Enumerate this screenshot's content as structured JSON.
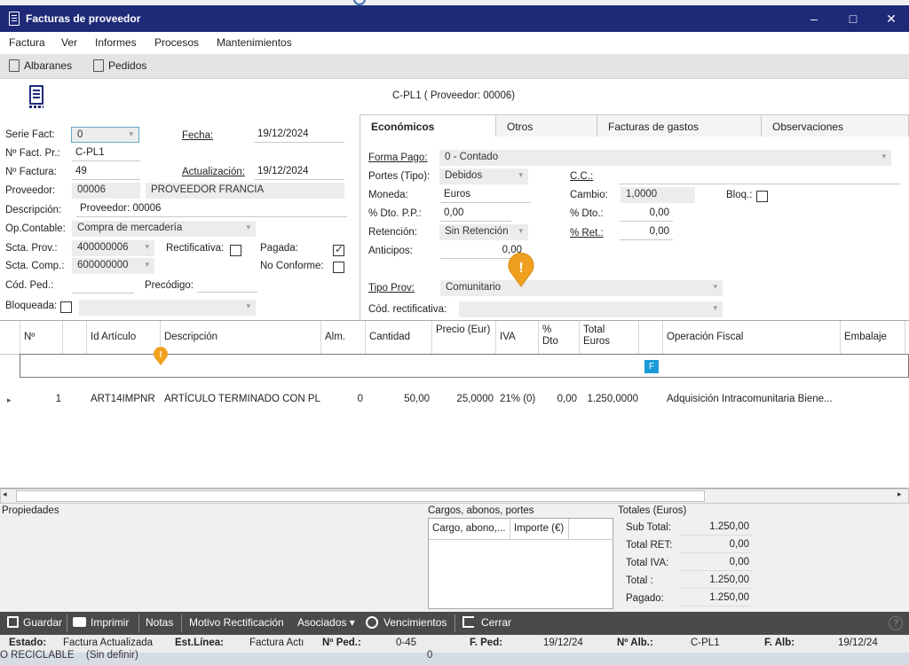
{
  "window": {
    "title": "Facturas de proveedor",
    "btn_min": "–",
    "btn_max": "□",
    "btn_close": "✕"
  },
  "menu": [
    "Factura",
    "Ver",
    "Informes",
    "Procesos",
    "Mantenimientos"
  ],
  "toolbar": {
    "albaranes": "Albaranes",
    "pedidos": "Pedidos"
  },
  "doc_header": "C-PL1 ( Proveedor: 00006)",
  "form": {
    "serie_label": "Serie Fact:",
    "serie_value": "0",
    "fecha_label": "Fecha:",
    "fecha_value": "19/12/2024",
    "nfactpr_label": "Nº Fact. Pr.:",
    "nfactpr_value": "C-PL1",
    "nfactura_label": "Nº Factura:",
    "nfactura_value": "49",
    "actualizacion_label": "Actualización:",
    "actualizacion_value": "19/12/2024",
    "proveedor_label": "Proveedor:",
    "proveedor_code": "00006",
    "proveedor_name": "PROVEEDOR FRANCIA",
    "descripcion_label": "Descripción:",
    "descripcion_value": "Proveedor: 00006",
    "opcontable_label": "Op.Contable:",
    "opcontable_value": "Compra de mercadería",
    "sctaprov_label": "Scta. Prov.:",
    "sctaprov_value": "400000006",
    "rectificativa_label": "Rectificativa:",
    "rectificativa_checked": false,
    "pagada_label": "Pagada:",
    "pagada_checked": true,
    "sctacomp_label": "Scta. Comp.:",
    "sctacomp_value": "600000000",
    "noconforme_label": "No Conforme:",
    "noconforme_checked": false,
    "codped_label": "Cód. Ped.:",
    "codped_value": "",
    "precodigo_label": "Precódigo:",
    "precodigo_value": "",
    "bloqueada_label": "Bloqueada:",
    "bloqueada_checked": false,
    "bloqueada_value": ""
  },
  "tabs": [
    "Económicos",
    "Otros",
    "Facturas de gastos",
    "Observaciones"
  ],
  "economicos": {
    "formapago_label": "Forma Pago:",
    "formapago_value": "0 - Contado",
    "portes_label": "Portes (Tipo):",
    "portes_value": "Debidos",
    "cc_label": "C.C.:",
    "cc_value": "",
    "moneda_label": "Moneda:",
    "moneda_value": "Euros",
    "cambio_label": "Cambio:",
    "cambio_value": "1,0000",
    "bloq_label": "Bloq.:",
    "bloq_checked": false,
    "dtopp_label": "% Dto. P.P.:",
    "dtopp_value": "0,00",
    "dto_label": "% Dto.:",
    "dto_value": "0,00",
    "retencion_label": "Retención:",
    "retencion_value": "Sin Retención",
    "ret_label": "% Ret.:",
    "ret_value": "0,00",
    "anticipos_label": "Anticipos:",
    "anticipos_value": "0,00",
    "tipoprov_label": "Tipo Prov:",
    "tipoprov_value": "Comunitario",
    "codrect_label": "Cód. rectificativa:",
    "codrect_value": ""
  },
  "grid": {
    "headers": {
      "n": "Nº",
      "id": "Id Artículo",
      "desc": "Descripción",
      "alm": "Alm.",
      "cant": "Cantidad",
      "precio": "Precio (Eur)",
      "iva": "IVA",
      "dto": "% Dto",
      "total": "Total Euros",
      "opfiscal": "Operación Fiscal",
      "embalaje": "Embalaje"
    },
    "rows": [
      {
        "n": "1",
        "id": "ART14IMPNR",
        "desc": "ARTÍCULO TERMINADO CON PL...",
        "alm": "0",
        "cant": "50,00",
        "precio": "25,0000",
        "iva": "21% (0)",
        "dto": "0,00",
        "total": "1.250,0000",
        "badge": "F",
        "opfiscal": "Adquisición Intracomunitaria Biene..."
      }
    ]
  },
  "alert_mark": "!",
  "row_marker": "▸",
  "scroll": {
    "left": "◂",
    "right": "▸"
  },
  "propiedades_label": "Propiedades",
  "cargos": {
    "label": "Cargos, abonos, portes",
    "col1": "Cargo, abono,...",
    "col2": "Importe (€)"
  },
  "totales": {
    "label": "Totales (Euros)",
    "subtotal_label": "Sub Total:",
    "subtotal_value": "1.250,00",
    "totalret_label": "Total RET:",
    "totalret_value": "0,00",
    "totaliva_label": "Total IVA:",
    "totaliva_value": "0,00",
    "total_label": "Total :",
    "total_value": "1.250,00",
    "pagado_label": "Pagado:",
    "pagado_value": "1.250,00"
  },
  "bottom": {
    "guardar": "Guardar",
    "imprimir": "Imprimir",
    "notas": "Notas",
    "motivo": "Motivo Rectificación",
    "asociados": "Asociados ▾",
    "vencimientos": "Vencimientos",
    "cerrar": "Cerrar",
    "help": "?"
  },
  "status": {
    "estado_label": "Estado:",
    "estado_value": "Factura Actualizada",
    "estlinea_label": "Est.Línea:",
    "estlinea_value": "Factura Actı",
    "nped_label": "Nº Ped.:",
    "nped_value": "0-45",
    "fped_label": "F. Ped:",
    "fped_value": "19/12/24",
    "nalb_label": "Nº Alb.:",
    "nalb_value": "C-PL1",
    "falb_label": "F. Alb:",
    "falb_value": "19/12/24"
  },
  "behind": {
    "text1": "O RECICLABLE",
    "text2": "(Sin definir)",
    "text3": "0"
  }
}
